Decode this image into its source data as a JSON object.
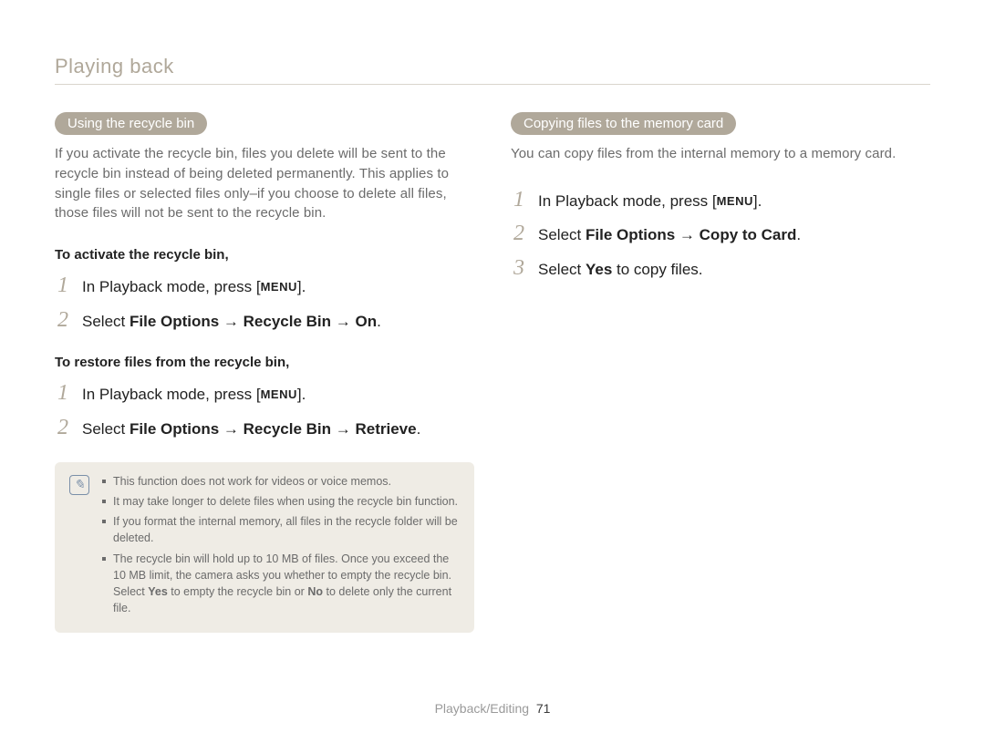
{
  "header": {
    "title": "Playing back"
  },
  "left": {
    "pill": "Using the recycle bin",
    "intro": "If you activate the recycle bin, files you delete will be sent to the recycle bin instead of being deleted permanently. This applies to single files or selected files only–if you choose to delete all files, those files will not be sent to the recycle bin.",
    "activate_head": "To activate the recycle bin,",
    "activate_steps": {
      "s1_pre": "In Playback mode, press [",
      "s1_menu": "MENU",
      "s1_post": "].",
      "s2_pre": "Select ",
      "s2_bold": "File Options → Recycle Bin → On",
      "s2_post": "."
    },
    "restore_head": "To restore files from the recycle bin,",
    "restore_steps": {
      "s1_pre": "In Playback mode, press [",
      "s1_menu": "MENU",
      "s1_post": "].",
      "s2_pre": "Select ",
      "s2_bold": "File Options → Recycle Bin → Retrieve",
      "s2_post": "."
    },
    "notes": {
      "n1": "This function does not work for videos or voice memos.",
      "n2": "It may take longer to delete files when using the recycle bin function.",
      "n3": "If you format the internal memory, all files in the recycle folder will be deleted.",
      "n4_a": "The recycle bin will hold up to 10 MB of files. Once you exceed the 10 MB limit, the camera asks you whether to empty the recycle bin. Select ",
      "n4_b": "Yes",
      "n4_c": " to empty the recycle bin or ",
      "n4_d": "No",
      "n4_e": " to delete only the current file."
    }
  },
  "right": {
    "pill": "Copying files to the memory card",
    "intro": "You can copy files from the internal memory to a memory card.",
    "steps": {
      "s1_pre": "In Playback mode, press [",
      "s1_menu": "MENU",
      "s1_post": "].",
      "s2_pre": "Select ",
      "s2_bold": "File Options → Copy to Card",
      "s2_post": ".",
      "s3_pre": "Select ",
      "s3_bold": "Yes",
      "s3_post": " to copy files."
    }
  },
  "footer": {
    "section": "Playback/Editing",
    "page": "71"
  },
  "nums": {
    "one": "1",
    "two": "2",
    "three": "3"
  }
}
